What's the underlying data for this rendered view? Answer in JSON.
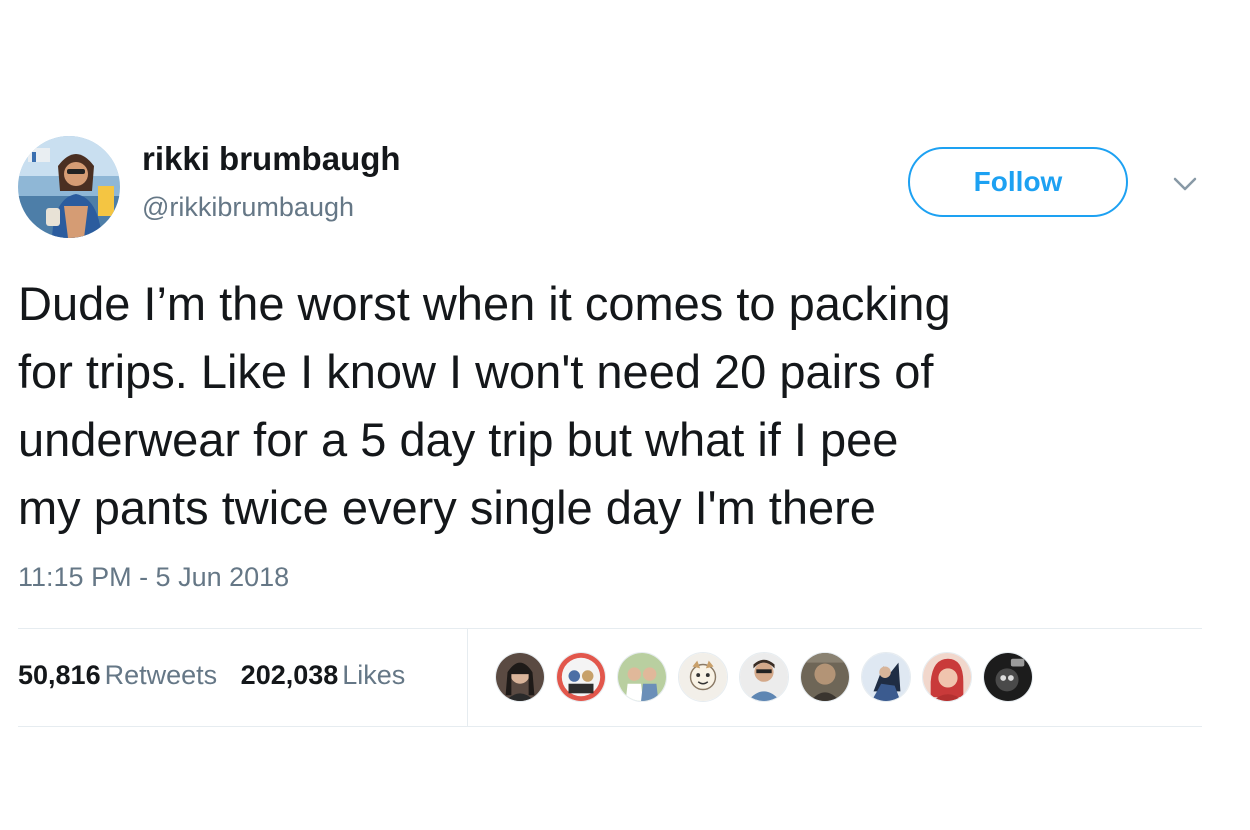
{
  "author": {
    "display_name": "rikki brumbaugh",
    "handle": "@rikkibrumbaugh",
    "avatar_icon": "profile-photo"
  },
  "follow_button": {
    "label": "Follow"
  },
  "menu": {
    "icon": "chevron-down-icon"
  },
  "tweet": {
    "text": "Dude I’m the worst when it comes to packing\nfor trips. Like I know I won't need 20 pairs of\nunderwear for a 5 day trip but what if I pee\nmy pants twice every single day I'm there",
    "timestamp": "11:15 PM - 5 Jun 2018"
  },
  "stats": {
    "retweets_count": "50,816",
    "retweets_label": "Retweets",
    "likes_count": "202,038",
    "likes_label": "Likes"
  },
  "likers": [
    {
      "name": "liker-avatar-1"
    },
    {
      "name": "liker-avatar-2"
    },
    {
      "name": "liker-avatar-3"
    },
    {
      "name": "liker-avatar-4"
    },
    {
      "name": "liker-avatar-5"
    },
    {
      "name": "liker-avatar-6"
    },
    {
      "name": "liker-avatar-7"
    },
    {
      "name": "liker-avatar-8"
    },
    {
      "name": "liker-avatar-9"
    }
  ],
  "colors": {
    "accent": "#1da1f2",
    "text_primary": "#14171a",
    "text_secondary": "#657786",
    "divider": "#e6ecf0"
  }
}
